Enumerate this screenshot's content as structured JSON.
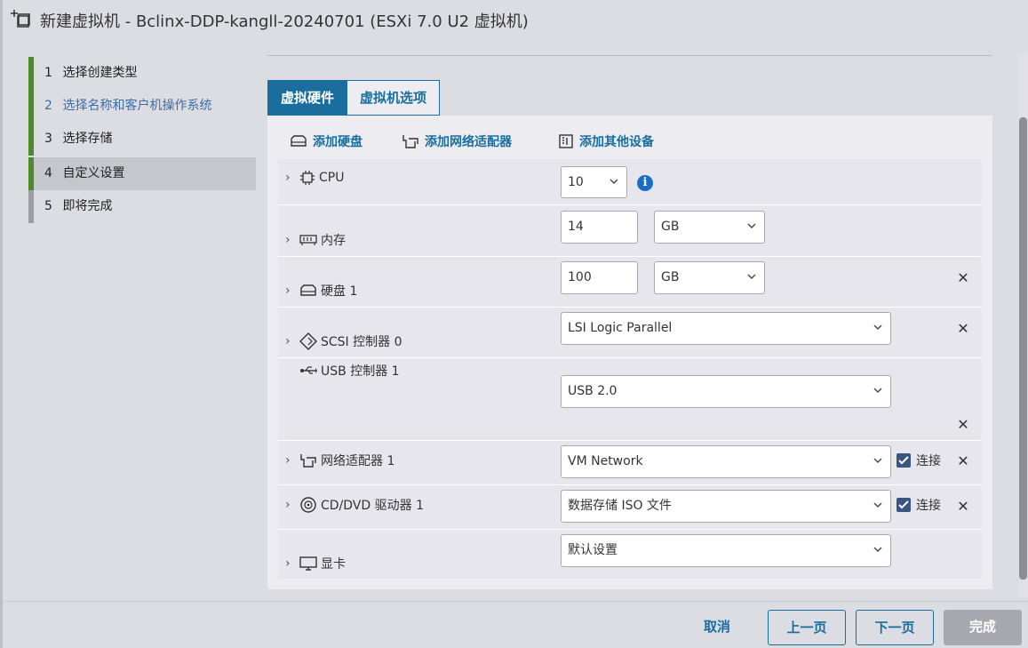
{
  "window": {
    "title": "新建虚拟机 - Bclinx-DDP-kangll-20240701 (ESXi 7.0 U2 虚拟机)"
  },
  "steps": [
    {
      "num": "1",
      "label": "选择创建类型"
    },
    {
      "num": "2",
      "label": "选择名称和客户机操作系统"
    },
    {
      "num": "3",
      "label": "选择存储"
    },
    {
      "num": "4",
      "label": "自定义设置"
    },
    {
      "num": "5",
      "label": "即将完成"
    }
  ],
  "tabs": {
    "hardware": "虚拟硬件",
    "options": "虚拟机选项"
  },
  "add_bar": {
    "add_disk": "添加硬盘",
    "add_nic": "添加网络适配器",
    "add_other": "添加其他设备"
  },
  "hardware": {
    "cpu": {
      "label": "CPU",
      "value": "10"
    },
    "memory": {
      "label": "内存",
      "value": "14",
      "unit": "GB"
    },
    "disk": {
      "label": "硬盘 1",
      "value": "100",
      "unit": "GB"
    },
    "scsi": {
      "label": "SCSI 控制器 0",
      "value": "LSI Logic Parallel"
    },
    "usb": {
      "label": "USB 控制器 1",
      "value": "USB 2.0"
    },
    "nic": {
      "label": "网络适配器 1",
      "value": "VM Network",
      "connect": "连接"
    },
    "cdrom": {
      "label": "CD/DVD 驱动器 1",
      "value": "数据存储 ISO 文件",
      "connect": "连接"
    },
    "video": {
      "label": "显卡",
      "value": "默认设置"
    }
  },
  "footer": {
    "cancel": "取消",
    "prev": "上一页",
    "next": "下一页",
    "finish": "完成"
  },
  "colors": {
    "accent": "#1a6e9e",
    "step_done": "#4c8a2a",
    "panel_bg": "#dcdce3"
  }
}
